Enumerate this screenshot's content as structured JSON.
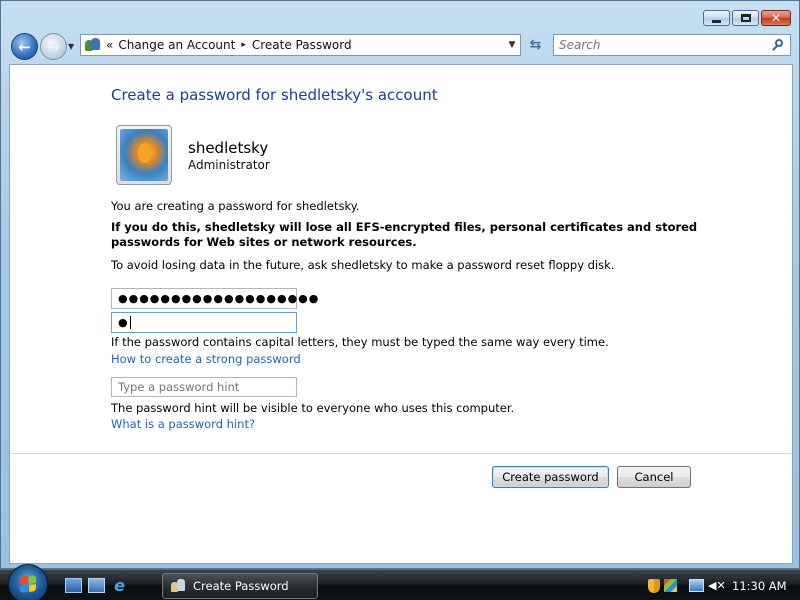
{
  "window": {
    "address": {
      "chevron": "«",
      "segments": [
        "Change an Account",
        "Create Password"
      ],
      "separator": "▸"
    },
    "search_placeholder": "Search"
  },
  "content": {
    "heading": "Create a password for shedletsky's account",
    "user": {
      "name": "shedletsky",
      "role": "Administrator"
    },
    "creating_text": "You are creating a password for shedletsky.",
    "warning_text": "If you do this, shedletsky will lose all EFS-encrypted files, personal certificates and stored passwords for Web sites or network resources.",
    "avoid_text": "To avoid losing data in the future, ask shedletsky to make a password reset floppy disk.",
    "new_password_value": "●●●●●●●●●●●●●●●●●●●",
    "confirm_password_value": "●",
    "caps_text": "If the password contains capital letters, they must be typed the same way every time.",
    "strong_link": "How to create a strong password",
    "hint_placeholder": "Type a password hint",
    "hint_visible_text": "The password hint will be visible to everyone who uses this computer.",
    "hint_link": "What is a password hint?",
    "create_button": "Create password",
    "cancel_button": "Cancel"
  },
  "taskbar": {
    "task_label": "Create Password",
    "clock": "11:30 AM"
  },
  "icons": [
    "back-arrow-icon",
    "forward-arrow-icon",
    "user-accounts-icon",
    "refresh-icon",
    "search-icon",
    "minimize-icon",
    "maximize-icon",
    "close-icon",
    "windows-flag-icon",
    "show-desktop-icon",
    "switch-windows-icon",
    "internet-explorer-icon",
    "security-shield-icon",
    "network-icon",
    "volume-mute-icon"
  ]
}
